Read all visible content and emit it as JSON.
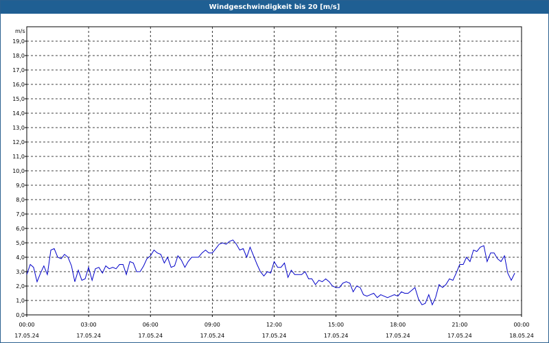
{
  "window": {
    "title": "Windgeschwindigkeit bis 20 [m/s]"
  },
  "chart_data": {
    "type": "line",
    "title": "Windgeschwindigkeit bis 20 [m/s]",
    "ylabel": "m/s",
    "xlabel": "",
    "ylim": [
      0,
      20
    ],
    "xlim_hours": [
      0,
      24
    ],
    "grid": true,
    "line_color": "#0000c8",
    "y_ticks": [
      "0,0",
      "1,0",
      "2,0",
      "3,0",
      "4,0",
      "5,0",
      "6,0",
      "7,0",
      "8,0",
      "9,0",
      "10,0",
      "11,0",
      "12,0",
      "13,0",
      "14,0",
      "15,0",
      "16,0",
      "17,0",
      "18,0",
      "19,0"
    ],
    "x_ticks": [
      {
        "time": "00:00",
        "date": "17.05.24"
      },
      {
        "time": "03:00",
        "date": "17.05.24"
      },
      {
        "time": "06:00",
        "date": "17.05.24"
      },
      {
        "time": "09:00",
        "date": "17.05.24"
      },
      {
        "time": "12:00",
        "date": "17.05.24"
      },
      {
        "time": "15:00",
        "date": "17.05.24"
      },
      {
        "time": "18:00",
        "date": "17.05.24"
      },
      {
        "time": "21:00",
        "date": "17.05.24"
      },
      {
        "time": "00:00",
        "date": "18.05.24"
      }
    ],
    "series": [
      {
        "x": [
          0.0,
          0.17,
          0.33,
          0.5,
          0.67,
          0.83,
          1.0,
          1.17,
          1.33,
          1.5,
          1.67,
          1.83,
          2.0,
          2.17,
          2.33,
          2.5,
          2.67,
          2.83,
          3.0,
          3.17,
          3.33,
          3.5,
          3.67,
          3.83,
          4.0,
          4.17,
          4.33,
          4.5,
          4.67,
          4.83,
          5.0,
          5.17,
          5.33,
          5.5,
          5.67,
          5.83,
          6.0,
          6.17,
          6.33,
          6.5,
          6.67,
          6.83,
          7.0,
          7.17,
          7.33,
          7.5,
          7.67,
          7.83,
          8.0,
          8.17,
          8.33,
          8.5,
          8.67,
          8.83,
          9.0,
          9.17,
          9.33,
          9.5,
          9.67,
          9.83,
          10.0,
          10.17,
          10.33,
          10.5,
          10.67,
          10.83,
          11.0,
          11.17,
          11.33,
          11.5,
          11.67,
          11.83,
          12.0,
          12.17,
          12.33,
          12.5,
          12.67,
          12.83,
          13.0,
          13.17,
          13.33,
          13.5,
          13.67,
          13.83,
          14.0,
          14.17,
          14.33,
          14.5,
          14.67,
          14.83,
          15.0,
          15.17,
          15.33,
          15.5,
          15.67,
          15.83,
          16.0,
          16.17,
          16.33,
          16.5,
          16.67,
          16.83,
          17.0,
          17.17,
          17.33,
          17.5,
          17.67,
          17.83,
          18.0,
          18.17,
          18.33,
          18.5,
          18.67,
          18.83,
          19.0,
          19.17,
          19.33,
          19.5,
          19.67,
          19.83,
          20.0,
          20.17,
          20.33,
          20.5,
          20.67,
          20.83,
          21.0,
          21.17,
          21.33,
          21.5,
          21.67,
          21.83,
          22.0,
          22.17,
          22.33,
          22.5,
          22.67,
          22.83,
          23.0,
          23.17,
          23.33,
          23.5,
          23.67
        ],
        "y": [
          2.8,
          3.5,
          3.3,
          2.3,
          2.9,
          3.4,
          2.8,
          4.5,
          4.6,
          4.0,
          3.9,
          4.2,
          4.0,
          3.4,
          2.3,
          3.1,
          2.4,
          2.5,
          3.3,
          2.4,
          3.2,
          3.3,
          2.9,
          3.4,
          3.2,
          3.3,
          3.2,
          3.5,
          3.5,
          2.8,
          3.7,
          3.6,
          3.0,
          3.0,
          3.4,
          3.9,
          4.1,
          4.5,
          4.3,
          4.2,
          3.6,
          4.0,
          3.3,
          3.4,
          4.1,
          3.8,
          3.3,
          3.7,
          4.0,
          4.0,
          4.0,
          4.3,
          4.5,
          4.3,
          4.3,
          4.6,
          4.9,
          5.0,
          4.9,
          5.1,
          5.2,
          4.9,
          4.5,
          4.6,
          4.0,
          4.7,
          4.1,
          3.5,
          3.0,
          2.7,
          3.0,
          2.9,
          3.7,
          3.3,
          3.3,
          3.6,
          2.6,
          3.1,
          2.8,
          2.8,
          2.8,
          3.0,
          2.5,
          2.5,
          2.1,
          2.4,
          2.3,
          2.5,
          2.3,
          2.0,
          1.9,
          1.9,
          2.2,
          2.3,
          2.2,
          1.6,
          2.0,
          1.9,
          1.4,
          1.3,
          1.4,
          1.5,
          1.2,
          1.4,
          1.3,
          1.2,
          1.3,
          1.4,
          1.3,
          1.6,
          1.5,
          1.5,
          1.7,
          1.9,
          1.1,
          0.7,
          0.8,
          1.4,
          0.7,
          1.2,
          2.1,
          1.9,
          2.1,
          2.5,
          2.4,
          2.9,
          3.5,
          3.5,
          4.0,
          3.7,
          4.5,
          4.4,
          4.7,
          4.8,
          3.7,
          4.3,
          4.3,
          3.9,
          3.7,
          4.1,
          2.9,
          2.4,
          2.9
        ]
      }
    ]
  }
}
